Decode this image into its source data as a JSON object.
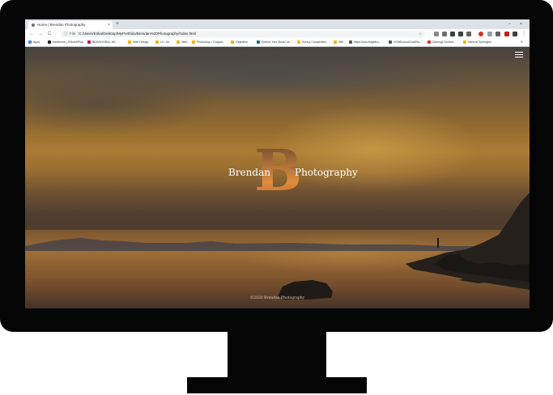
{
  "browser": {
    "tab_title": "Home | Brendan Photography",
    "tab_close": "×",
    "new_tab": "+",
    "window_minimize": "–",
    "window_close": "×",
    "back": "←",
    "forward": "→",
    "reload": "C",
    "info": "ⓘ",
    "scheme": "File",
    "url": "C:/Users/Erika/Desktop/MyPortfolio/Brendan%20Photography/index.html",
    "star": "☆",
    "menu_dots": "⋮"
  },
  "bookmarks": [
    {
      "label": "Apps",
      "color": "#4285f4"
    },
    {
      "label": "Sentiment | ENwebPlus",
      "color": "#1f1f1f"
    },
    {
      "label": "BEHAVIORAL HE...",
      "color": "#c2185b"
    },
    {
      "label": "Web Design",
      "color": "#f4b400"
    },
    {
      "label": "UI / UX",
      "color": "#f4b400"
    },
    {
      "label": "Web",
      "color": "#f4b400"
    },
    {
      "label": "Photoshop / Graphic",
      "color": "#f4b400"
    },
    {
      "label": "Objective",
      "color": "#f4b400"
    },
    {
      "label": "Search Your Bookl Ja...",
      "color": "#0f6e8f"
    },
    {
      "label": "Sunny Competition",
      "color": "#f4b400"
    },
    {
      "label": "Wifi",
      "color": "#f4b400"
    },
    {
      "label": "https://sun.angelico...",
      "color": "#555555"
    },
    {
      "label": "r/OldSchoolCool/Ra...",
      "color": "#555555"
    },
    {
      "label": "Disneyjil Studios",
      "color": "#d93025"
    },
    {
      "label": "Internal Synergies",
      "color": "#f4b400"
    }
  ],
  "bookmarks_more": "»",
  "page": {
    "brand_left": "Brendan",
    "brand_letter": "B",
    "brand_right": "Photography",
    "footer": "©2020 Brendan Photography"
  },
  "colors": {
    "monitor": "#050505",
    "accent_orange": "#e08c3c"
  }
}
